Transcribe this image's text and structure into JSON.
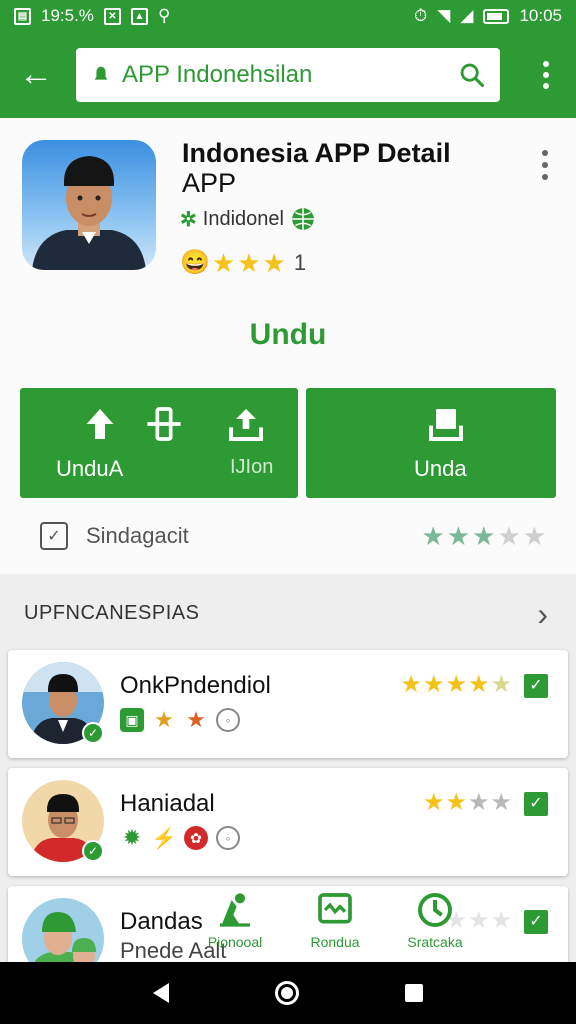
{
  "status_bar": {
    "left_text": "19:5.%",
    "time": "10:05"
  },
  "search": {
    "query": "APP Indonehsilan"
  },
  "app": {
    "title": "Indonesia APP Detail",
    "subtitle": "APP",
    "developer": "Indidonel",
    "rating_count": "1",
    "headline": "Undu"
  },
  "actions": {
    "left_label": "UnduA",
    "left_secondary": "IJIon",
    "right_label": "Unda"
  },
  "checkbox_row": {
    "label": "Sindagacit"
  },
  "section": {
    "title": "UPFNCANESPIAS"
  },
  "list": [
    {
      "name": "OnkPndendiol",
      "stars": 4.5
    },
    {
      "name": "Haniadal",
      "stars": 2.5
    },
    {
      "name": "Dandas",
      "subtitle": "Pnede Aalt",
      "stars": 2
    }
  ],
  "bottom_tabs": [
    {
      "label": "Pionooal",
      "icon": "person-pin-icon"
    },
    {
      "label": "Rondua",
      "icon": "inbox-icon"
    },
    {
      "label": "Sratcaka",
      "icon": "clock-icon"
    }
  ],
  "colors": {
    "primary": "#2e9a34",
    "star": "#f4c21a",
    "muted_star": "#7bb89a"
  }
}
